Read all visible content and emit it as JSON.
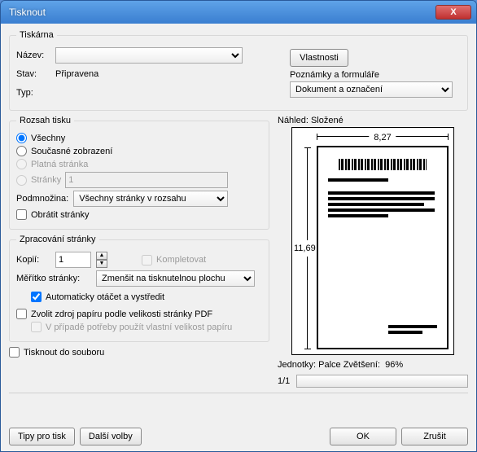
{
  "window": {
    "title": "Tisknout",
    "close_icon": "X"
  },
  "printer": {
    "legend": "Tiskárna",
    "name_label": "Název:",
    "name_value": "",
    "status_label": "Stav:",
    "status_value": "Připravena",
    "type_label": "Typ:",
    "type_value": "",
    "properties_btn": "Vlastnosti",
    "comments_label": "Poznámky a formuláře",
    "comments_value": "Dokument a označení"
  },
  "range": {
    "legend": "Rozsah tisku",
    "all": "Všechny",
    "current_view": "Současné zobrazení",
    "current_page": "Platná stránka",
    "pages": "Stránky",
    "pages_value": "1",
    "subset_label": "Podmnožina:",
    "subset_value": "Všechny stránky v rozsahu",
    "reverse": "Obrátit stránky"
  },
  "handling": {
    "legend": "Zpracování stránky",
    "copies_label": "Kopií:",
    "copies_value": "1",
    "collate": "Kompletovat",
    "scaling_label": "Měřítko stránky:",
    "scaling_value": "Zmenšit na tisknutelnou plochu",
    "auto_rotate": "Automaticky otáčet a vystředit",
    "paper_source": "Zvolit zdroj papíru podle velikosti stránky PDF",
    "custom_size": "V případě potřeby použít vlastní velikost papíru"
  },
  "print_to_file": "Tisknout do souboru",
  "preview": {
    "label": "Náhled: Složené",
    "width": "8,27",
    "height": "11,69",
    "units_label": "Jednotky: Palce Zvětšení:",
    "zoom": "96%",
    "page_counter": "1/1"
  },
  "buttons": {
    "tips": "Tipy pro tisk",
    "advanced": "Další volby",
    "ok": "OK",
    "cancel": "Zrušit"
  }
}
